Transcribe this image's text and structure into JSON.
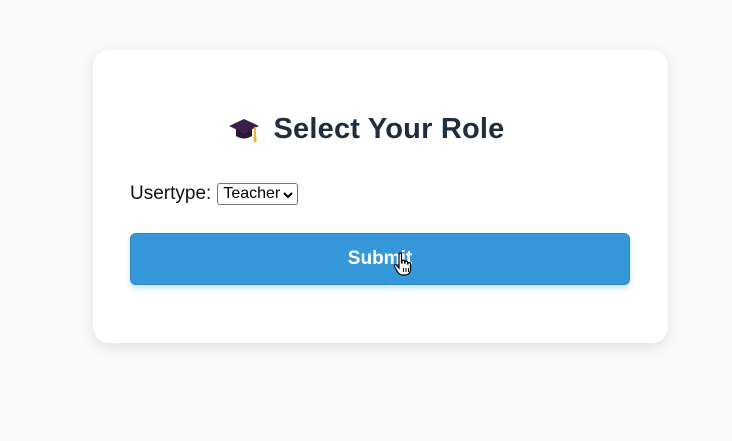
{
  "page": {
    "background_color": "#fafafa"
  },
  "card": {
    "icon": "graduation-cap-icon",
    "title": "Select Your Role",
    "usertype_label": "Usertype:",
    "usertype_selected": "Teacher",
    "submit_label": "Submit",
    "accent_color": "#3498db",
    "title_color": "#1f2d3d"
  },
  "cursor": {
    "icon": "hand-pointer-cursor-icon"
  }
}
